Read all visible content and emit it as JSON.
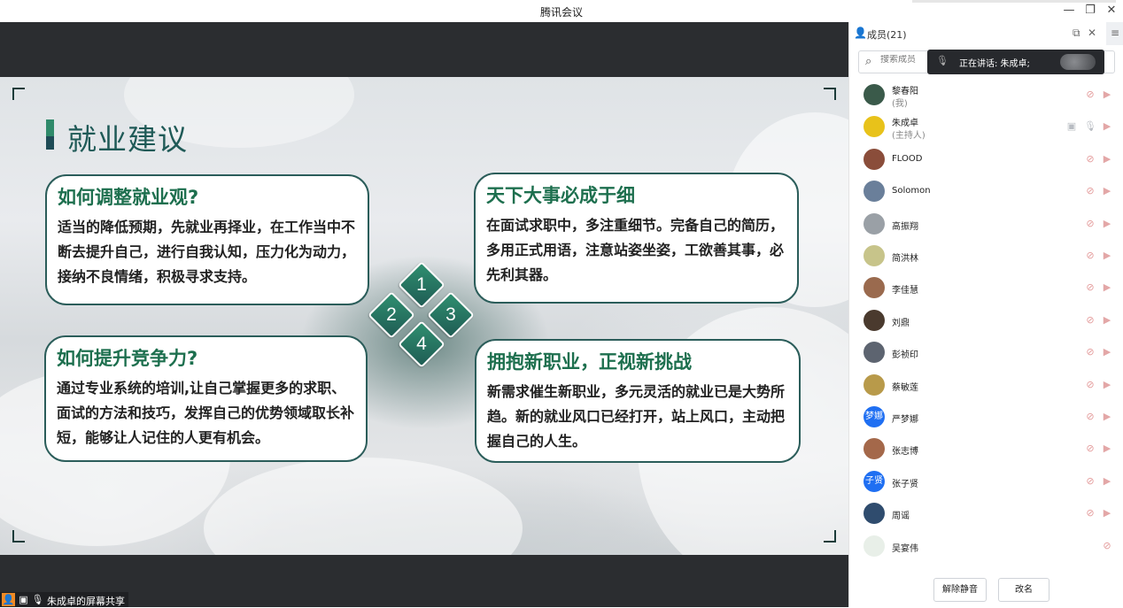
{
  "window": {
    "title": "腾讯会议"
  },
  "slide": {
    "heading": "就业建议",
    "cards": [
      {
        "title": "如何调整就业观?",
        "body": "适当的降低预期，先就业再择业，在工作当中不断去提升自己，进行自我认知，压力化为动力，接纳不良情绪，积极寻求支持。"
      },
      {
        "title": "天下大事必成于细",
        "body": "在面试求职中，多注重细节。完备自己的简历，多用正式用语，注意站姿坐姿，工欲善其事，必先利其器。"
      },
      {
        "title": "如何提升竞争力?",
        "body": "通过专业系统的培训,让自己掌握更多的求职、面试的方法和技巧，发挥自己的优势领域取长补短，能够让人记住的人更有机会。"
      },
      {
        "title": "拥抱新职业，正视新挑战",
        "body": "新需求催生新职业，多元灵活的就业已是大势所趋。新的就业风口已经打开，站上风口，主动把握自己的人生。"
      }
    ],
    "diamonds": [
      "1",
      "2",
      "3",
      "4"
    ]
  },
  "share_bar": {
    "label": "朱成卓的屏幕共享"
  },
  "panel": {
    "title": "成员(21)",
    "search_placeholder": "搜索成员",
    "speaking_text": "正在讲话: 朱成卓;",
    "members": [
      {
        "name": "黎春阳",
        "role": "(我)",
        "avatar_color": "#3a5a4a",
        "avatar_text": "",
        "mic": "off",
        "cam": "off",
        "screen": false
      },
      {
        "name": "朱成卓",
        "role": "(主持人)",
        "avatar_color": "#e8c21a",
        "avatar_text": "",
        "mic": "on",
        "cam": "off",
        "screen": true
      },
      {
        "name": "FLOOD",
        "role": "",
        "avatar_color": "#8a4d3a",
        "avatar_text": "",
        "mic": "off",
        "cam": "off",
        "screen": false
      },
      {
        "name": "Solomon",
        "role": "",
        "avatar_color": "#6a7f9a",
        "avatar_text": "",
        "mic": "off",
        "cam": "off",
        "screen": false
      },
      {
        "name": "高振翔",
        "role": "",
        "avatar_color": "#9aa0a6",
        "avatar_text": "",
        "mic": "off",
        "cam": "off",
        "screen": false
      },
      {
        "name": "简洪林",
        "role": "",
        "avatar_color": "#c7c48a",
        "avatar_text": "",
        "mic": "off",
        "cam": "off",
        "screen": false
      },
      {
        "name": "李佳慧",
        "role": "",
        "avatar_color": "#9a6a4e",
        "avatar_text": "",
        "mic": "off",
        "cam": "off",
        "screen": false
      },
      {
        "name": "刘鼎",
        "role": "",
        "avatar_color": "#4a3a2e",
        "avatar_text": "",
        "mic": "off",
        "cam": "off",
        "screen": false
      },
      {
        "name": "彭祯印",
        "role": "",
        "avatar_color": "#5d6470",
        "avatar_text": "",
        "mic": "off",
        "cam": "off",
        "screen": false
      },
      {
        "name": "蔡敏莲",
        "role": "",
        "avatar_color": "#b89a4a",
        "avatar_text": "",
        "mic": "off",
        "cam": "off",
        "screen": false
      },
      {
        "name": "严梦娜",
        "role": "",
        "avatar_color": "#1f6ff2",
        "avatar_text": "梦娜",
        "mic": "off",
        "cam": "off",
        "screen": false
      },
      {
        "name": "张志博",
        "role": "",
        "avatar_color": "#a4684a",
        "avatar_text": "",
        "mic": "off",
        "cam": "off",
        "screen": false
      },
      {
        "name": "张子贤",
        "role": "",
        "avatar_color": "#1f6ff2",
        "avatar_text": "子贤",
        "mic": "off",
        "cam": "off",
        "screen": false
      },
      {
        "name": "周谣",
        "role": "",
        "avatar_color": "#2f4c6e",
        "avatar_text": "",
        "mic": "off",
        "cam": "off",
        "screen": false
      },
      {
        "name": "吴宴伟",
        "role": "",
        "avatar_color": "#e8efe8",
        "avatar_text": "",
        "mic": "off",
        "cam": "none",
        "screen": false
      }
    ],
    "buttons": {
      "unmute_all": "解除静音",
      "rename": "改名"
    }
  }
}
